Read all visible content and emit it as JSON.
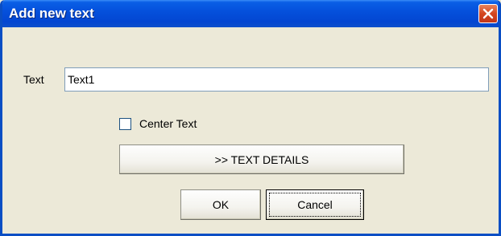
{
  "dialog": {
    "title": "Add new text",
    "close_icon": "close-icon"
  },
  "form": {
    "text_label": "Text",
    "text_value": "Text1",
    "center_text_label": "Center Text",
    "center_text_checked": false,
    "details_button_label": ">> TEXT DETAILS",
    "ok_label": "OK",
    "cancel_label": "Cancel"
  },
  "colors": {
    "titlebar": "#0551dc",
    "window_bg": "#ece9d8",
    "close_button": "#d4461f"
  }
}
